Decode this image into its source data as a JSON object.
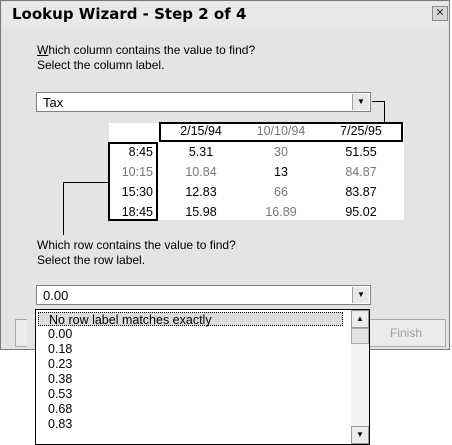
{
  "window": {
    "title": "Lookup Wizard - Step 2 of 4",
    "close_glyph": "✕"
  },
  "column_prompt": {
    "line1": "Which column contains the value to find?",
    "line2": "Select the column label."
  },
  "column_select": {
    "value": "Tax"
  },
  "table": {
    "headers": [
      "2/15/94",
      "10/10/94",
      "7/25/95"
    ],
    "rows": [
      {
        "label": "8:45",
        "values": [
          "5.31",
          "30",
          "51.55"
        ]
      },
      {
        "label": "10:15",
        "values": [
          "10.84",
          "13",
          "84.87"
        ]
      },
      {
        "label": "15:30",
        "values": [
          "12.83",
          "66",
          "83.87"
        ]
      },
      {
        "label": "18:45",
        "values": [
          "15.98",
          "16.89",
          "95.02"
        ]
      }
    ]
  },
  "row_prompt": {
    "line1": "Which row contains the value to find?",
    "line2": "Select the row label."
  },
  "row_select": {
    "value": "0.00",
    "options": [
      "No row label matches exactly",
      "0.00",
      "0.18",
      "0.23",
      "0.38",
      "0.53",
      "0.68",
      "0.83"
    ]
  },
  "buttons": {
    "finish": "Finish"
  }
}
